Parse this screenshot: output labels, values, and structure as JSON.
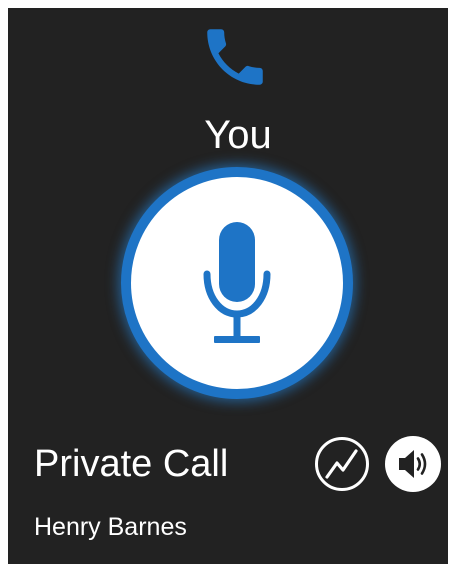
{
  "header": {
    "call_icon": "phone-handset-icon",
    "speaker_label": "You"
  },
  "ptt": {
    "icon": "microphone-icon"
  },
  "call": {
    "type": "Private Call",
    "name": "Henry Barnes"
  },
  "actions": {
    "signal_icon": "signal-activity-icon",
    "speaker_icon": "speaker-volume-icon"
  },
  "colors": {
    "background": "#222222",
    "accent": "#1e74c6",
    "text": "#ffffff"
  }
}
